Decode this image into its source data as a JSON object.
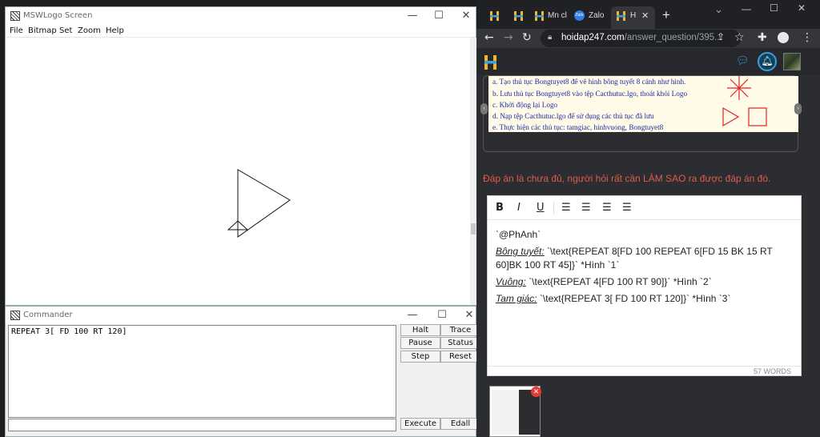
{
  "logo_window": {
    "title": "MSWLogo Screen",
    "menu": [
      "File",
      "Bitmap",
      "Set",
      "Zoom",
      "Help"
    ],
    "controls": {
      "minimize": "—",
      "maximize": "☐",
      "close": "✕"
    }
  },
  "commander": {
    "title": "Commander",
    "history": "REPEAT 3[ FD 100 RT 120]",
    "input_value": "",
    "buttons": {
      "halt": "Halt",
      "trace": "Trace",
      "pause": "Pause",
      "status": "Status",
      "step": "Step",
      "reset": "Reset",
      "execute": "Execute",
      "edall": "Edall"
    },
    "controls": {
      "minimize": "—",
      "maximize": "☐",
      "close": "✕"
    }
  },
  "browser": {
    "tabs": [
      {
        "icon": "hoidap-h-icon",
        "label": ""
      },
      {
        "icon": "hoidap-h-icon",
        "label": ""
      },
      {
        "icon": "hoidap-h-icon",
        "label": "Mn cl"
      },
      {
        "icon": "zalo-icon",
        "label": "Zalo"
      },
      {
        "icon": "hoidap-h-icon",
        "label": "H"
      }
    ],
    "new_tab": "+",
    "window_controls": {
      "chevron": "⌄",
      "minimize": "—",
      "maximize": "☐",
      "close": "✕"
    },
    "url_host": "hoidap247.com",
    "url_path": "/answer_question/395..."
  },
  "question": {
    "lines": [
      "a. Tạo thủ tục Bongtuyet8 để vẽ hình bông tuyết 8 cánh như hình.",
      "b. Lưu thủ tục Bongtuyet8 vào tệp Cacthutuc.lgo, thoát khỏi Logo",
      "c. Khởi động lại Logo",
      "d. Nạp tệp Cacthutuc.lgo để sử dụng các thủ tục đã lưu",
      "e. Thực hiện các thủ tục: tamgiac, hinhvuong, Bongtuyet8"
    ]
  },
  "notice": "Đáp án là chưa đủ, người hỏi rất cần LÀM SAO ra được đáp án đó.",
  "editor": {
    "toolbar": {
      "bold": "B",
      "italic": "I",
      "underline": "U"
    },
    "mention": "`@PhAnh`",
    "snowflake_label": "Bông tuyết:",
    "snowflake_code": " `\\text{REPEAT 8[FD 100 REPEAT 6[FD 15 BK 15 RT 60]BK 100 RT 45]}` *Hình `1`",
    "square_label": "Vuông:",
    "square_code": " `\\text{REPEAT 4[FD 100 RT 90]}` *Hình `2`",
    "triangle_label": "Tam giác:",
    "triangle_code": " `\\text{REPEAT 3[ FD 100 RT 120]}` *Hình `3`",
    "word_count": "57 WORDS"
  },
  "colors": {
    "accent_h": "#f5b52a",
    "notice": "#e25a4a",
    "close_badge": "#e53935"
  }
}
